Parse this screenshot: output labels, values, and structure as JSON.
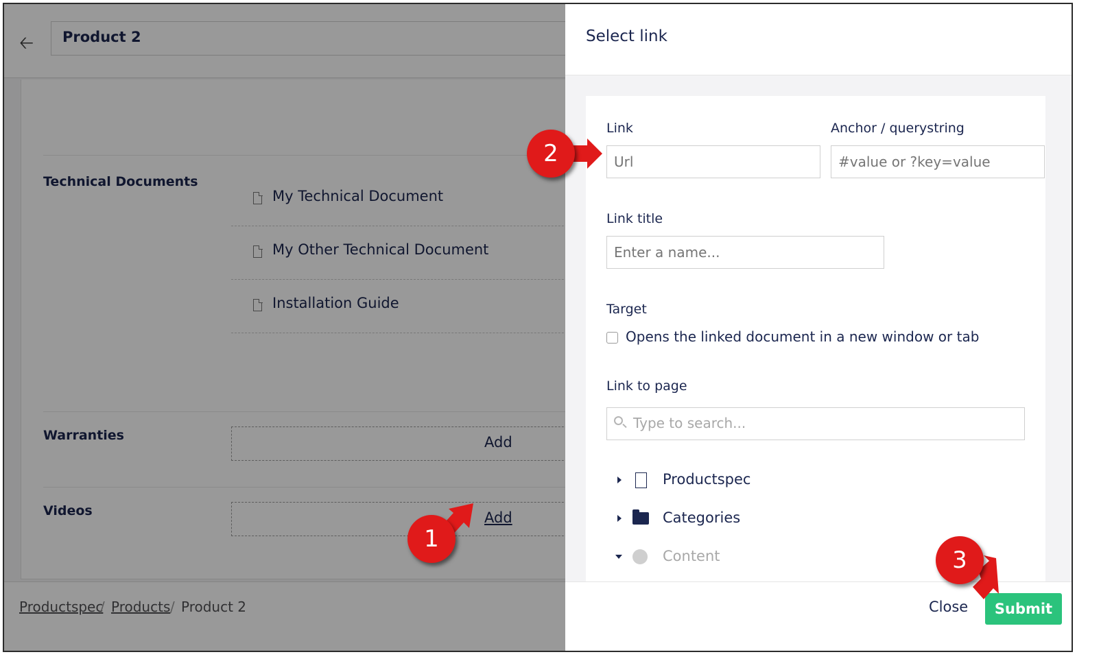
{
  "left": {
    "back_icon": "arrow-left-icon",
    "title": "Product 2",
    "properties": {
      "technical_documents": {
        "label": "Technical Documents",
        "items": [
          "My Technical Document",
          "My Other Technical Document",
          "Installation Guide"
        ]
      },
      "warranties": {
        "label": "Warranties",
        "add_label": "Add"
      },
      "videos": {
        "label": "Videos",
        "add_label": "Add"
      }
    },
    "breadcrumb": [
      "Productspec",
      "Products",
      "Product 2"
    ],
    "breadcrumb_separator": "/"
  },
  "panel": {
    "title": "Select link",
    "link": {
      "label": "Link",
      "placeholder": "Url"
    },
    "anchor": {
      "label": "Anchor / querystring",
      "placeholder": "#value or ?key=value"
    },
    "link_title": {
      "label": "Link title",
      "placeholder": "Enter a name..."
    },
    "target": {
      "label": "Target",
      "checkbox_label": "Opens the linked document in a new window or tab"
    },
    "link_to_page": {
      "label": "Link to page",
      "search_placeholder": "Type to search..."
    },
    "tree": [
      {
        "label": "Productspec",
        "icon": "document-icon",
        "expanded": false
      },
      {
        "label": "Categories",
        "icon": "folder-icon",
        "expanded": false
      },
      {
        "label": "Content",
        "icon": "globe-icon",
        "expanded": true
      }
    ],
    "close_label": "Close",
    "submit_label": "Submit"
  },
  "markers": [
    "1",
    "2",
    "3"
  ],
  "colors": {
    "accent_green": "#2bc37c",
    "marker_red": "#e01a1a",
    "text_navy": "#1b264f"
  }
}
